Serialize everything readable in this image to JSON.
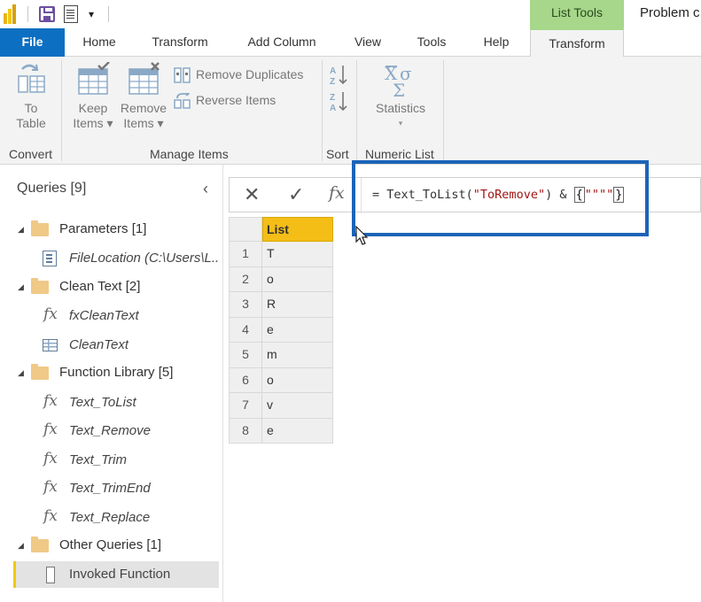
{
  "window": {
    "context_tab": "List Tools",
    "document_title": "Problem c"
  },
  "quick_access": {
    "dropdown_glyph": "▾"
  },
  "tabs": [
    {
      "label": "File"
    },
    {
      "label": "Home"
    },
    {
      "label": "Transform"
    },
    {
      "label": "Add Column"
    },
    {
      "label": "View"
    },
    {
      "label": "Tools"
    },
    {
      "label": "Help"
    },
    {
      "label": "Transform",
      "active": true
    }
  ],
  "ribbon": {
    "convert": {
      "to_table_l1": "To",
      "to_table_l2": "Table",
      "group_label": "Convert"
    },
    "manage_items": {
      "keep_l1": "Keep",
      "keep_l2": "Items ▾",
      "remove_l1": "Remove",
      "remove_l2": "Items ▾",
      "remove_duplicates": "Remove Duplicates",
      "reverse_items": "Reverse Items",
      "group_label": "Manage Items"
    },
    "sort": {
      "group_label": "Sort"
    },
    "numeric_list": {
      "statistics": "Statistics",
      "statistics_caret": "▾",
      "group_label": "Numeric List"
    }
  },
  "queries": {
    "title": "Queries [9]",
    "collapse_glyph": "‹",
    "groups": [
      {
        "label": "Parameters [1]",
        "items": [
          "FileLocation (C:\\Users\\L..."
        ]
      },
      {
        "label": "Clean Text [2]",
        "items": [
          "fxCleanText",
          "CleanText"
        ]
      },
      {
        "label": "Function Library [5]",
        "items": [
          "Text_ToList",
          "Text_Remove",
          "Text_Trim",
          "Text_TrimEnd",
          "Text_Replace"
        ]
      },
      {
        "label": "Other Queries [1]",
        "items": [
          "Invoked Function"
        ]
      }
    ]
  },
  "formula_bar": {
    "prefix": "= Text_ToList(",
    "string_arg": "\"ToRemove\"",
    "middle": ") & ",
    "brace_open": "{",
    "brace_string": "\"\"\"\"",
    "brace_close": "}"
  },
  "grid": {
    "column_header": "List",
    "rows": [
      {
        "n": "1",
        "v": "T"
      },
      {
        "n": "2",
        "v": "o"
      },
      {
        "n": "3",
        "v": "R"
      },
      {
        "n": "4",
        "v": "e"
      },
      {
        "n": "5",
        "v": "m"
      },
      {
        "n": "6",
        "v": "o"
      },
      {
        "n": "7",
        "v": "v"
      },
      {
        "n": "8",
        "v": "e"
      }
    ]
  },
  "colors": {
    "file_tab": "#0d6fc2",
    "context_tab": "#a6d78a",
    "column_header": "#f4be17",
    "highlight_box": "#1c64b8"
  }
}
